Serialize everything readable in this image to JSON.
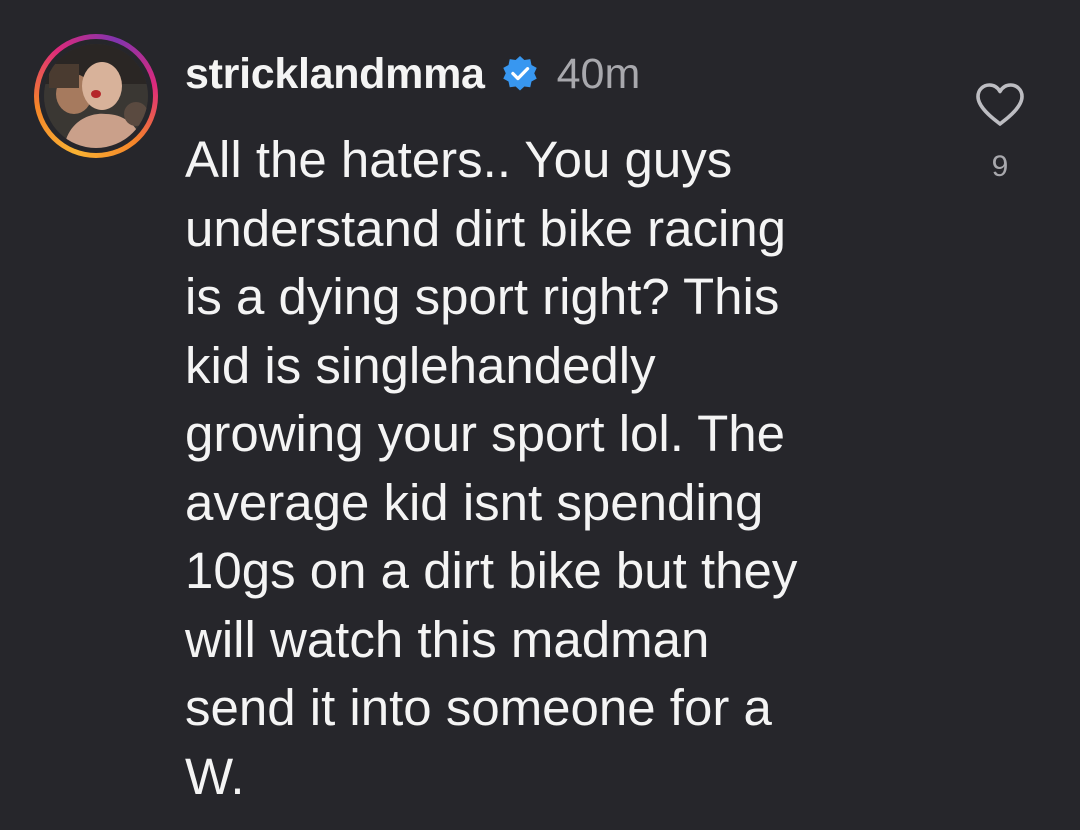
{
  "comment": {
    "username": "stricklandmma",
    "verified_icon": "verified-badge-icon",
    "timestamp": "40m",
    "text_lines": [
      "All the haters.. You guys",
      "understand dirt bike racing",
      "is a dying sport right? This",
      "kid is singlehandedly",
      "growing your sport lol. The",
      "average kid isnt spending",
      "10gs on a dirt bike but they",
      "will watch this madman",
      "send it into someone for a",
      "W."
    ],
    "like_icon": "heart-outline-icon",
    "like_count": "9"
  },
  "colors": {
    "background": "#26262b",
    "text": "#f4f4f4",
    "muted": "#a8a8ad",
    "verified_blue": "#3897f0"
  }
}
